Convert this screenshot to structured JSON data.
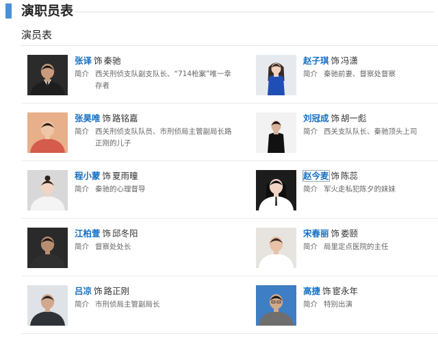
{
  "section": {
    "title": "演职员表"
  },
  "subsection": {
    "title": "演员表"
  },
  "as_word": "饰",
  "intro_label": "简介",
  "cast_rows": [
    {
      "left": {
        "actor": "张译",
        "role": "秦驰",
        "intro": "西关刑侦支队副支队长、“714枪案”唯一幸存者",
        "photo": "photo-zhang-yi"
      },
      "right": {
        "actor": "赵子琪",
        "role": "冯潇",
        "intro": "秦驰前妻、督察处督察",
        "photo": "photo-zhao-ziqi"
      }
    },
    {
      "left": {
        "actor": "张昊唯",
        "role": "路铭嘉",
        "intro": "西关刑侦支队队员、市刑侦局主管副局长路正刚的儿子",
        "photo": "photo-zhang-haowei"
      },
      "right": {
        "actor": "刘冠成",
        "role": "胡一彪",
        "intro": "西关支队队长、秦驰顶头上司",
        "photo": "photo-liu-guancheng"
      }
    },
    {
      "left": {
        "actor": "程小蒙",
        "role": "夏雨曈",
        "intro": "秦驰的心理督导",
        "photo": "photo-cheng-xiaomeng"
      },
      "right": {
        "actor": "赵今麦",
        "role": "陈蕊",
        "intro": "军火走私犯陈夕的妹妹",
        "photo": "photo-zhao-jinmai"
      }
    },
    {
      "left": {
        "actor": "江柏萱",
        "role": "邱冬阳",
        "intro": "督察处处长",
        "photo": "photo-jiang-baixuan"
      },
      "right": {
        "actor": "宋春丽",
        "role": "娄颐",
        "intro": "局里定点医院的主任",
        "photo": "photo-song-chunli"
      }
    },
    {
      "left": {
        "actor": "吕凉",
        "role": "路正刚",
        "intro": "市刑侦局主管副局长",
        "photo": "photo-lv-liang"
      },
      "right": {
        "actor": "高捷",
        "role": "宦永年",
        "intro": "特别出演",
        "photo": "photo-gao-jie"
      }
    }
  ]
}
